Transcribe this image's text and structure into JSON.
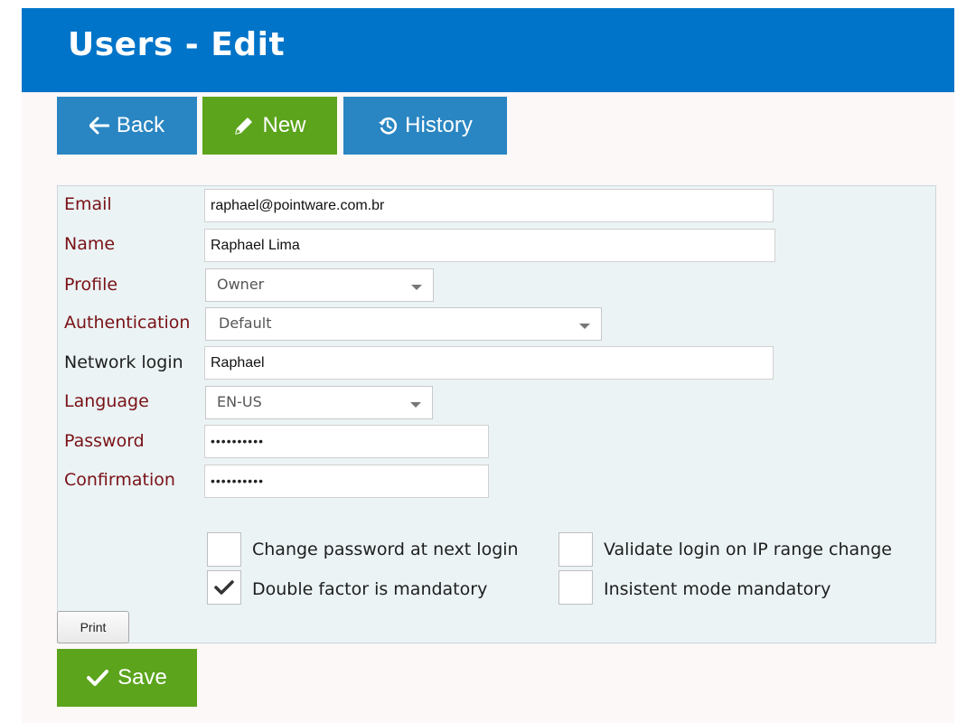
{
  "header": {
    "title": "Users - Edit"
  },
  "toolbar": {
    "back_label": "Back",
    "new_label": "New",
    "history_label": "History"
  },
  "form": {
    "email": {
      "label": "Email",
      "value": "raphael@pointware.com.br"
    },
    "name": {
      "label": "Name",
      "value": "Raphael Lima"
    },
    "profile": {
      "label": "Profile",
      "value": "Owner"
    },
    "authentication": {
      "label": "Authentication",
      "value": "Default"
    },
    "network_login": {
      "label": "Network login",
      "value": "Raphael"
    },
    "language": {
      "label": "Language",
      "value": "EN-US"
    },
    "password": {
      "label": "Password",
      "value": "••••••••••"
    },
    "confirmation": {
      "label": "Confirmation",
      "value": "••••••••••"
    }
  },
  "options": {
    "change_password": {
      "label": "Change password at next login",
      "checked": false
    },
    "validate_login_ip": {
      "label": "Validate login on IP range change",
      "checked": false
    },
    "double_factor": {
      "label": "Double factor is mandatory",
      "checked": true
    },
    "insistent_mode": {
      "label": "Insistent mode mandatory",
      "checked": false
    }
  },
  "actions": {
    "print_label": "Print",
    "save_label": "Save"
  },
  "colors": {
    "header_bg": "#0074c8",
    "primary_button": "#2a86c2",
    "success_button": "#5ba41c",
    "required_label": "#7a1216",
    "panel_bg": "#ebf3f5"
  },
  "icons": {
    "back": "arrow-left-icon",
    "new": "pencil-icon",
    "history": "history-icon",
    "save": "checkmark-icon",
    "checked": "checkmark-icon"
  }
}
